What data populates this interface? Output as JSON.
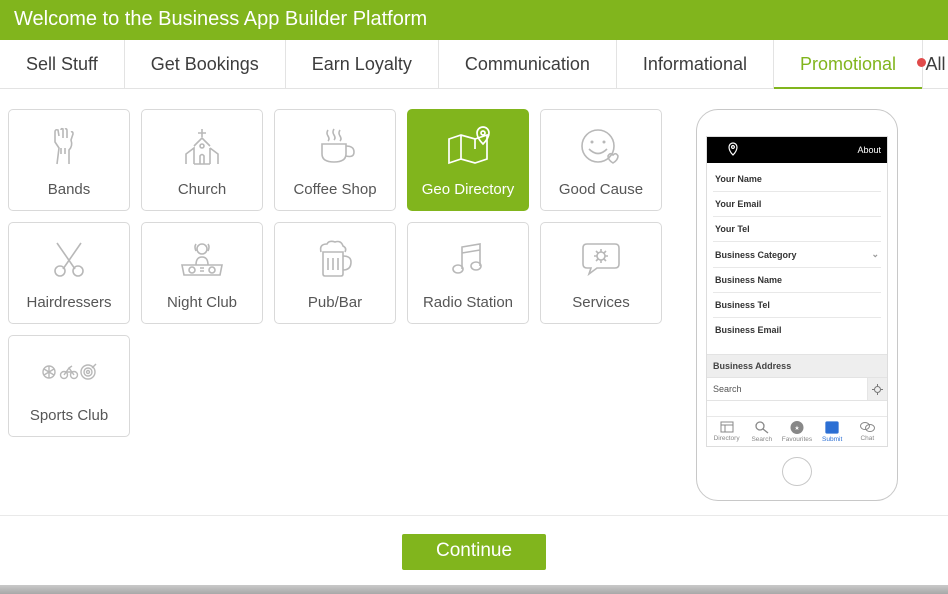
{
  "header": {
    "title": "Welcome to the Business App Builder Platform"
  },
  "tabs": [
    {
      "label": "Sell Stuff"
    },
    {
      "label": "Get Bookings"
    },
    {
      "label": "Earn Loyalty"
    },
    {
      "label": "Communication"
    },
    {
      "label": "Informational"
    },
    {
      "label": "Promotional",
      "active": true
    },
    {
      "label": "All",
      "has_dot": true
    }
  ],
  "tiles": [
    {
      "label": "Bands",
      "icon": "bands"
    },
    {
      "label": "Church",
      "icon": "church"
    },
    {
      "label": "Coffee Shop",
      "icon": "coffee"
    },
    {
      "label": "Geo Directory",
      "icon": "geo",
      "active": true
    },
    {
      "label": "Good Cause",
      "icon": "smile"
    },
    {
      "label": "Hairdressers",
      "icon": "scissors"
    },
    {
      "label": "Night Club",
      "icon": "dj"
    },
    {
      "label": "Pub/Bar",
      "icon": "beer"
    },
    {
      "label": "Radio Station",
      "icon": "music"
    },
    {
      "label": "Services",
      "icon": "chat-gear"
    },
    {
      "label": "Sports Club",
      "icon": "sports"
    }
  ],
  "preview": {
    "topbar_right": "About",
    "form_rows": [
      "Your Name",
      "Your Email",
      "Your Tel",
      "Business Category",
      "Business Name",
      "Business Tel",
      "Business Email"
    ],
    "dropdown_row_index": 3,
    "section_header": "Business Address",
    "search_placeholder": "Search",
    "bottom_nav": [
      {
        "label": "Directory"
      },
      {
        "label": "Search"
      },
      {
        "label": "Favourites"
      },
      {
        "label": "Submit",
        "active": true
      },
      {
        "label": "Chat"
      }
    ]
  },
  "continue_label": "Continue"
}
